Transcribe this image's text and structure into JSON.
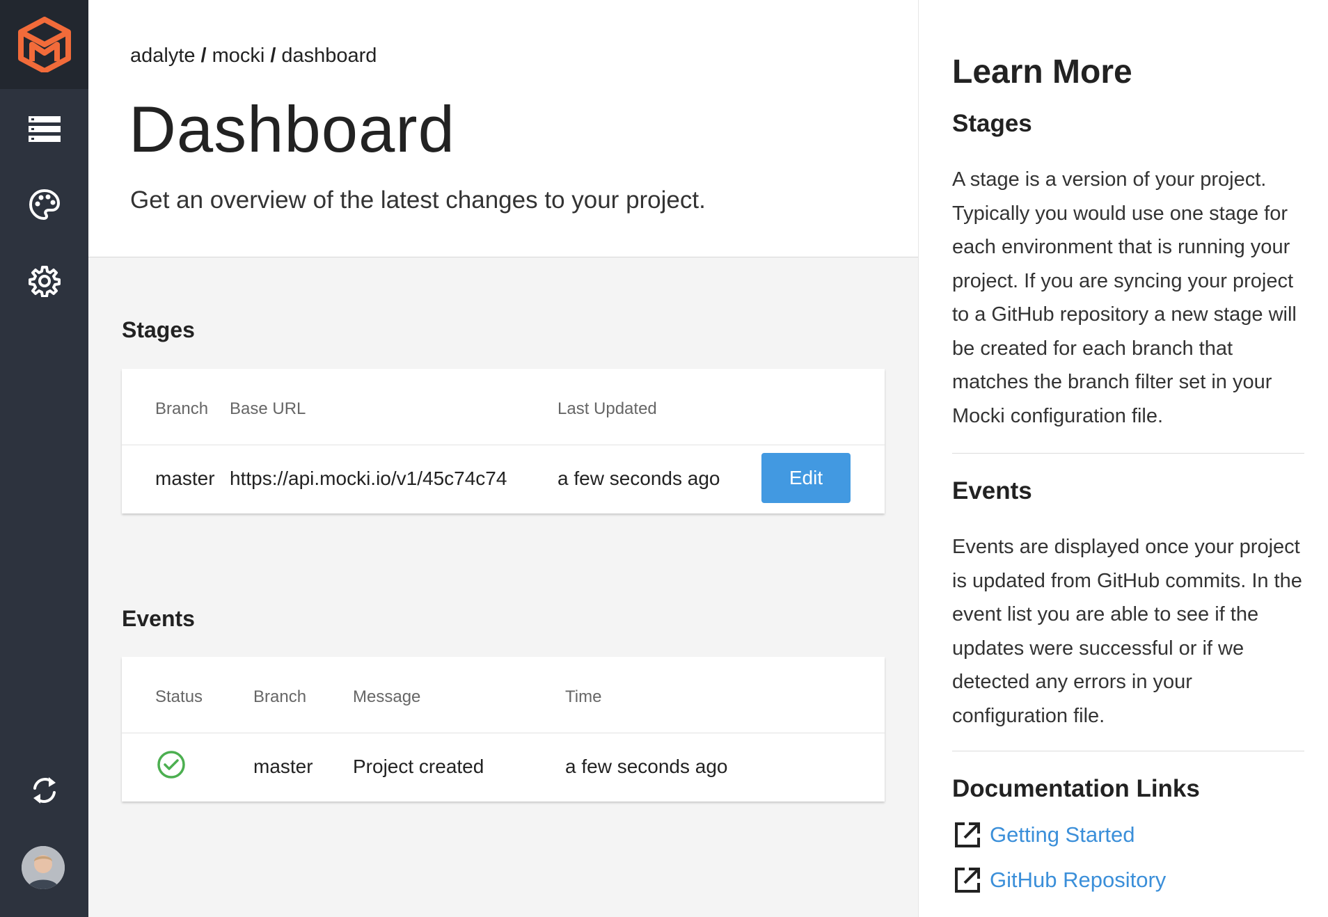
{
  "breadcrumb": {
    "org": "adalyte",
    "project": "mocki",
    "page": "dashboard",
    "separator": "/"
  },
  "header": {
    "title": "Dashboard",
    "subtitle": "Get an overview of the latest changes to your project."
  },
  "sidebar": {
    "icons": [
      "logo-icon",
      "list-icon",
      "palette-icon",
      "gear-icon",
      "sync-icon"
    ],
    "brand_color": "#f26b3a"
  },
  "stages": {
    "title": "Stages",
    "columns": {
      "branch": "Branch",
      "base_url": "Base URL",
      "last_updated": "Last Updated"
    },
    "rows": [
      {
        "branch": "master",
        "base_url": "https://api.mocki.io/v1/45c74c74",
        "last_updated": "a few seconds ago",
        "action": "Edit"
      }
    ]
  },
  "events": {
    "title": "Events",
    "columns": {
      "status": "Status",
      "branch": "Branch",
      "message": "Message",
      "time": "Time"
    },
    "rows": [
      {
        "status": "success",
        "branch": "master",
        "message": "Project created",
        "time": "a few seconds ago"
      }
    ]
  },
  "learn_more": {
    "title": "Learn More",
    "stages_heading": "Stages",
    "stages_text": "A stage is a version of your project. Typically you would use one stage for each environment that is running your project. If you are syncing your project to a GitHub repository a new stage will be created for each branch that matches the branch filter set in your Mocki configuration file.",
    "events_heading": "Events",
    "events_text": "Events are displayed once your project is updated from GitHub commits. In the event list you are able to see if the updates were successful or if we detected any errors in your configuration file.",
    "docs_heading": "Documentation Links",
    "links": [
      "Getting Started",
      "GitHub Repository"
    ]
  },
  "colors": {
    "accent": "#4299e1",
    "link": "#3b8fd9",
    "success": "#4caf50",
    "sidebar": "#2d333e"
  }
}
